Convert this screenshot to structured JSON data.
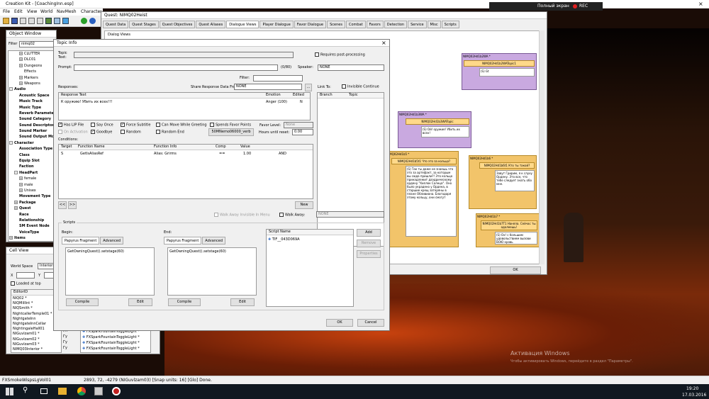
{
  "app": {
    "title": "Creation Kit - [CoachingInn.esp]",
    "menus": [
      "File",
      "Edit",
      "View",
      "World",
      "NavMesh",
      "Character"
    ]
  },
  "recbar": {
    "label": "Полный экран",
    "rec": "REC"
  },
  "object_window": {
    "title": "Object Window",
    "filter_label": "Filter",
    "filter_value": "nimq02",
    "tree": [
      {
        "t": "CLUTTER",
        "i": 2,
        "e": "+"
      },
      {
        "t": "DLC01",
        "i": 2,
        "e": "+"
      },
      {
        "t": "Dungeons",
        "i": 2,
        "e": "+"
      },
      {
        "t": "Effects",
        "i": 2,
        "e": ""
      },
      {
        "t": "Markers",
        "i": 2,
        "e": "+"
      },
      {
        "t": "Weapons",
        "i": 2,
        "e": "+"
      },
      {
        "t": "Audio",
        "i": 0,
        "e": "-",
        "b": true
      },
      {
        "t": "Acoustic Space",
        "i": 1,
        "e": "",
        "b": true
      },
      {
        "t": "Music Track",
        "i": 1,
        "e": "",
        "b": true
      },
      {
        "t": "Music Type",
        "i": 1,
        "e": "",
        "b": true
      },
      {
        "t": "Reverb Parameters",
        "i": 1,
        "e": "",
        "b": true
      },
      {
        "t": "Sound Category",
        "i": 1,
        "e": "",
        "b": true
      },
      {
        "t": "Sound Descriptor",
        "i": 1,
        "e": "",
        "b": true
      },
      {
        "t": "Sound Marker",
        "i": 1,
        "e": "",
        "b": true
      },
      {
        "t": "Sound Output Model",
        "i": 1,
        "e": "",
        "b": true
      },
      {
        "t": "Character",
        "i": 0,
        "e": "-",
        "b": true
      },
      {
        "t": "Association Type",
        "i": 1,
        "e": "",
        "b": true
      },
      {
        "t": "Class",
        "i": 1,
        "e": "",
        "b": true
      },
      {
        "t": "Equip Slot",
        "i": 1,
        "e": "",
        "b": true
      },
      {
        "t": "Faction",
        "i": 1,
        "e": "",
        "b": true
      },
      {
        "t": "HeadPart",
        "i": 1,
        "e": "-",
        "b": true
      },
      {
        "t": "female",
        "i": 2,
        "e": "+"
      },
      {
        "t": "male",
        "i": 2,
        "e": "+"
      },
      {
        "t": "Unisex",
        "i": 2,
        "e": "+"
      },
      {
        "t": "Movement Type",
        "i": 1,
        "e": "",
        "b": true
      },
      {
        "t": "Package",
        "i": 1,
        "e": "+",
        "b": true
      },
      {
        "t": "Quest",
        "i": 1,
        "e": "+",
        "b": true
      },
      {
        "t": "Race",
        "i": 1,
        "e": "",
        "b": true
      },
      {
        "t": "Relationship",
        "i": 1,
        "e": "",
        "b": true
      },
      {
        "t": "SM Event Node",
        "i": 1,
        "e": "",
        "b": true
      },
      {
        "t": "VoiceType",
        "i": 1,
        "e": "",
        "b": true
      },
      {
        "t": "Items",
        "i": 0,
        "e": "+",
        "b": true
      }
    ]
  },
  "cell_view": {
    "title": "Cell View",
    "worldspace_label": "World Space",
    "worldspace_value": "Interiors",
    "x_label": "X",
    "y_label": "Y",
    "loaded_label": "Loaded at top",
    "col_editor": "EditorID",
    "rows": [
      "NIQ02 *",
      "NIQMillInt *",
      "NIQSmith *",
      "NightcallerTemple01 *",
      "NightgateInn",
      "NightgateInnCellar",
      "NightingaleHall01",
      "NIGuvlzam01 *",
      "NIGuvlzam02 *",
      "NIGuvlzam03 *",
      "NIMQ03Interior *"
    ],
    "refs": [
      "FXSparkFountainToggleLight *",
      "FXSparkFountainToggleLight *",
      "FXSparkFountainToggleLight *",
      "FXSparkFountainToggleLight *"
    ],
    "side": [
      "Пт",
      "Гу",
      "Гу",
      "Гу"
    ]
  },
  "status": {
    "left": "FXSmokeWispsLgVol01",
    "right": "2893, 72, -4279 (NIGuvlzam03) [Snap units: 16] [Glo] Done."
  },
  "quest": {
    "title": "Quest: NIMQ02Heist",
    "tabs": [
      "Quest Data",
      "Quest Stages",
      "Quest Objectives",
      "Quest Aliases",
      "Dialogue Views",
      "Player Dialogue",
      "Favor Dialogue",
      "Scenes",
      "Combat",
      "Favors",
      "Detection",
      "Service",
      "Misc",
      "Scripts"
    ],
    "selected_tab": "Dialogue Views",
    "views_label": "Dialog Views",
    "ok": "OK",
    "nodes": {
      "n1_title": "NIMQ02Hd1b2WA *",
      "n1_sub": "NIMQ02Hd1b2WATopic1",
      "n1_text": "(S) Gt",
      "n2_title": "NIMQ02Hd1b3WA *",
      "n2_sub": "NIMQ02Hd1b3WATopic",
      "n2_text": "(S) Ой! оружие! Убить их всех!",
      "n3_title": "NIMQ02Hd1b5 *",
      "n3_sub": "NIMQ02Hd1b5t1 Что это за кольцо?",
      "n3_text": "(S) Так ты даже не знаешь что это за артефакт, за которым вы сюда пришли?! Это кольцо принадлежит даэдрическому ордену \"Хиллок Солнца\". Оно было украдено у Ордена, в старшие крещ затеряны в плане Обливиона. Благодаря этому кольцу, они смогут",
      "n4_title": "NIMQ02Hd1b6 *",
      "n4_sub": "NIMQ02Hd1b6t1 Кто ты такой?",
      "n4_text": "Зовут Гририм, я к слуху Ордену. Это все, что тебе следует знать обо мне.",
      "n5_title": "NIMQ02Hd1b7 *",
      "n5_sub": "NIMQ02Hd1b7T1 Наняла. Сейчас ты одолеешь!",
      "n5_text": "(S) Ох! с большим удовольствием вызови ВОЮ кровь"
    }
  },
  "topic": {
    "title": "Topic Info",
    "topic_text_label": "Topic Text:",
    "requires_post": "Requires post-processing",
    "prompt_label": "Prompt:",
    "prompt_count": "(0/80)",
    "speaker_label": "Speaker:",
    "speaker_value": "NONE",
    "filter_label": "Filter:",
    "responses_label": "Responses:",
    "share_label": "Share Response Data From Info:",
    "share_value": "NONE",
    "link_to": "Link To:",
    "invisible_continue": "Invisible Continue",
    "resp_cols": [
      "Response Text",
      "Emotion",
      "Edited"
    ],
    "resp_row": {
      "text": "К оружию! Убить их всех!!!",
      "emotion": "Anger (100)",
      "edited": "N"
    },
    "branch_cols": [
      "Branch",
      "Topic"
    ],
    "checks": {
      "has_lip": "Has LIP File",
      "say_once": "Say Once",
      "force_subtitle": "Force Subtitle",
      "can_move": "Can Move While Greeting",
      "spends_favor": "Spends Favor Points",
      "favor_level_label": "Favor Level:",
      "favor_level_value": "None",
      "on_activation": "On Activation",
      "goodbye": "Goodbye",
      "random": "Random",
      "random_end": "Random End",
      "shared_info": "50MNemo06000_verb",
      "hours_label": "Hours until reset:",
      "hours_value": "0.00"
    },
    "conditions_label": "Conditions:",
    "cond_cols": [
      "Target",
      "Function Name",
      "Function Info",
      "Comp",
      "Value",
      ""
    ],
    "cond_row": {
      "target": "S",
      "fn": "GetIsAliasRef",
      "info": "Alias: Grirms",
      "comp": "==",
      "value": "1.00",
      "op": "AND"
    },
    "nav_prev": "<<",
    "nav_next": ">>",
    "new_btn": "New",
    "walk_away_invis": "Walk Away Invisible In Menu",
    "walk_away": "Walk Away:",
    "walk_away_value": "NONE",
    "scripts_label": "Scripts",
    "begin_label": "Begin:",
    "end_label": "End:",
    "papyrus_tab": "Papyrus Fragment",
    "advanced_tab": "Advanced",
    "begin_code": "GetOwningQuest().setstage(60)",
    "end_code": "GetOwningQuest().setstage(60)",
    "compile": "Compile",
    "edit": "Edit",
    "script_name_col": "Script Name",
    "script_name": "TIF__043D069A",
    "add": "Add",
    "remove": "Remove",
    "properties": "Properties",
    "ok": "OK",
    "cancel": "Cancel"
  },
  "watermark": {
    "line1": "Активация Windows",
    "line2": "Чтобы активировать Windows, перейдите в раздел \"Параметры\"."
  },
  "taskbar": {
    "time": "19:20",
    "date": "17.03.2016"
  },
  "colors": {
    "accent": "#0078d7",
    "node_purple": "#c9a9e0",
    "node_yellow": "#f2c46a"
  }
}
